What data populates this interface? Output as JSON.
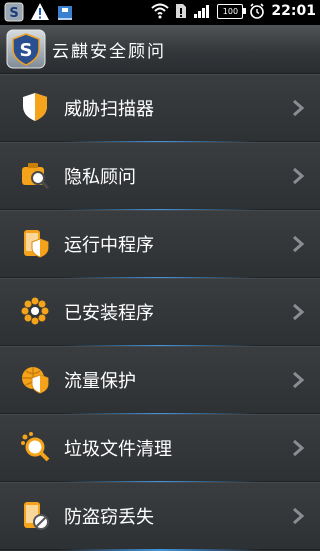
{
  "status_bar": {
    "time": "22:01",
    "battery_text": "100"
  },
  "header": {
    "title": "云麒安全顾问"
  },
  "menu": {
    "items": [
      {
        "label": "威胁扫描器",
        "icon": "shield-icon"
      },
      {
        "label": "隐私顾问",
        "icon": "privacy-magnifier-icon"
      },
      {
        "label": "运行中程序",
        "icon": "phone-shield-icon"
      },
      {
        "label": "已安装程序",
        "icon": "installed-apps-icon"
      },
      {
        "label": "流量保护",
        "icon": "globe-shield-icon"
      },
      {
        "label": "垃圾文件清理",
        "icon": "cleanup-magnifier-icon"
      },
      {
        "label": "防盗窃丢失",
        "icon": "anti-theft-phone-icon"
      }
    ]
  },
  "colors": {
    "accent_orange": "#f5a31a",
    "divider_blue": "#46aaff"
  }
}
